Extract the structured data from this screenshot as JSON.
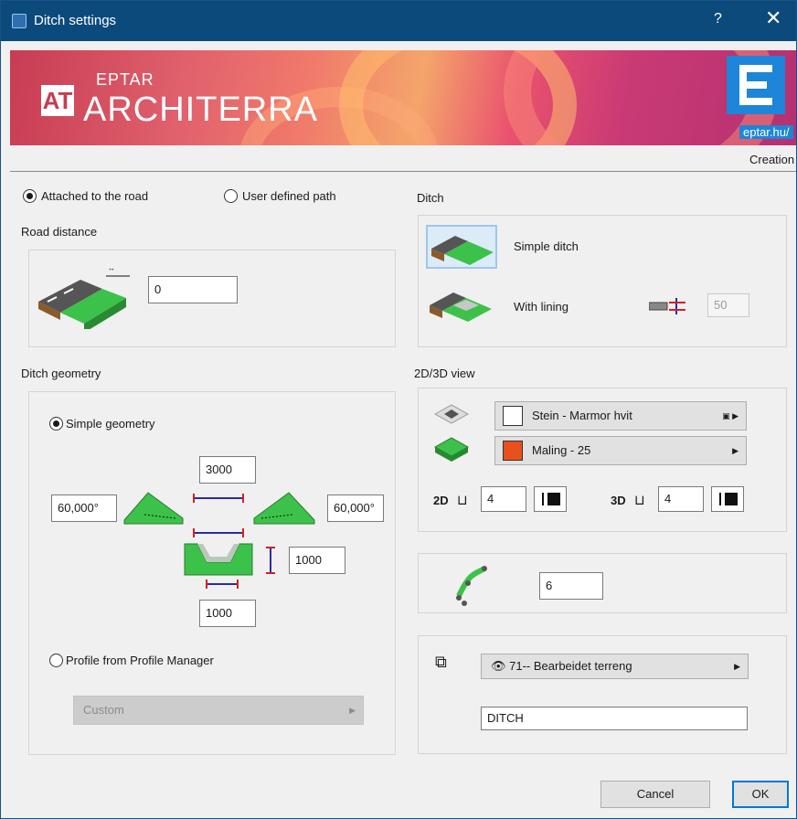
{
  "window": {
    "title": "Ditch settings",
    "help_glyph": "?",
    "close_glyph": "✕"
  },
  "banner": {
    "brand_small": "EPTAR",
    "brand_large": "ARCHITERRA",
    "logo_letters": "AT",
    "site": "eptar.hu/"
  },
  "tab": {
    "label": "Creation"
  },
  "path_mode": {
    "attached_label": "Attached to the road",
    "user_defined_label": "User defined path",
    "selected": "attached"
  },
  "road_distance": {
    "heading": "Road distance",
    "value": "0"
  },
  "ditch_geometry": {
    "heading": "Ditch geometry",
    "simple_label": "Simple geometry",
    "profile_label": "Profile from Profile Manager",
    "selected": "simple",
    "top_width": "3000",
    "left_angle": "60,000°",
    "right_angle": "60,000°",
    "depth": "1000",
    "bottom_width": "1000",
    "profile_dropdown": "Custom"
  },
  "ditch": {
    "heading": "Ditch",
    "simple_label": "Simple ditch",
    "lining_label": "With lining",
    "lining_value": "50",
    "selected": "simple"
  },
  "view_2d3d": {
    "heading": "2D/3D view",
    "surface_top": "Stein - Marmor hvit",
    "surface_top_color": "#ffffff",
    "surface_side": "Maling - 25",
    "surface_side_color": "#e8501e",
    "pen_2d_label": "2D",
    "pen_2d_value": "4",
    "pen_3d_label": "3D",
    "pen_3d_value": "4"
  },
  "segments": {
    "value": "6"
  },
  "layer": {
    "name": "71-- Bearbeidet terreng",
    "id_value": "DITCH"
  },
  "buttons": {
    "cancel": "Cancel",
    "ok": "OK"
  },
  "colors": {
    "titlebar": "#0c4a7c",
    "accent": "#0078d7",
    "ditch_green": "#3cc24a"
  }
}
